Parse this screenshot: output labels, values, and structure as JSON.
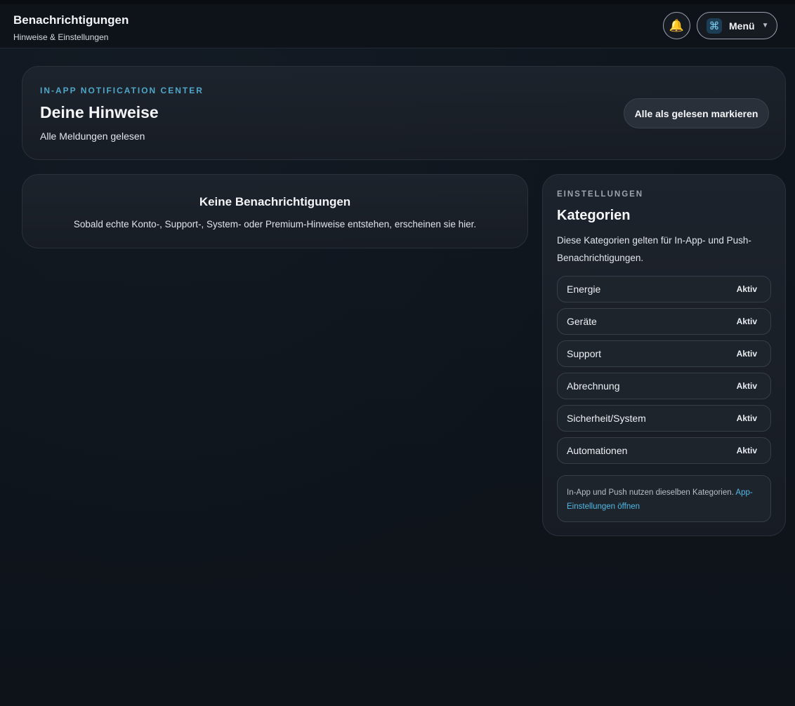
{
  "header": {
    "title": "Benachrichtigungen",
    "subtitle": "Hinweise & Einstellungen",
    "menu_label": "Menü",
    "menu_icon": "⌘",
    "bell_icon": "🔔",
    "caret": "▼"
  },
  "hero": {
    "kicker": "IN-APP NOTIFICATION CENTER",
    "title": "Deine Hinweise",
    "subtitle": "Alle Meldungen gelesen",
    "mark_all_label": "Alle als gelesen markieren"
  },
  "empty_state": {
    "title": "Keine Benachrichtigungen",
    "text": "Sobald echte Konto-, Support-, System- oder Premium-Hinweise entstehen, erscheinen sie hier."
  },
  "settings": {
    "kicker": "EINSTELLUNGEN",
    "title": "Kategorien",
    "description": "Diese Kategorien gelten für In-App- und Push-Benachrichtigungen.",
    "categories": [
      {
        "label": "Energie",
        "status": "Aktiv"
      },
      {
        "label": "Geräte",
        "status": "Aktiv"
      },
      {
        "label": "Support",
        "status": "Aktiv"
      },
      {
        "label": "Abrechnung",
        "status": "Aktiv"
      },
      {
        "label": "Sicherheit/System",
        "status": "Aktiv"
      },
      {
        "label": "Automationen",
        "status": "Aktiv"
      }
    ],
    "note_text": "In-App und Push nutzen dieselben Kategorien.",
    "note_link": "App-Einstellungen öffnen"
  },
  "colors": {
    "background": "#0f141b",
    "accent": "#4fa6c9",
    "link": "#52b9e6"
  }
}
